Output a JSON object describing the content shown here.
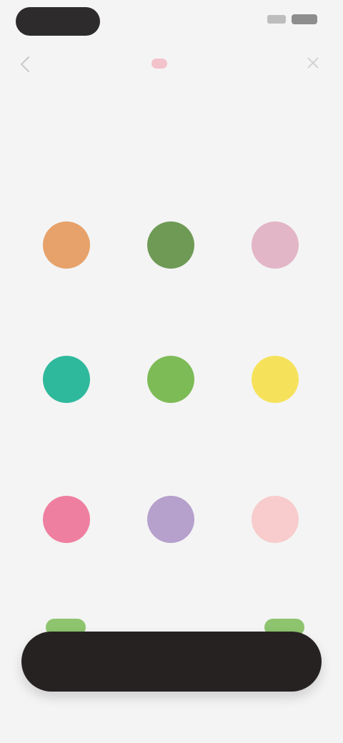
{
  "nav": {
    "back_icon": "chevron-left-icon",
    "close_icon": "close-icon",
    "brand_color": "#f3c2cb"
  },
  "headline": "",
  "categories": [
    {
      "label": "",
      "color": "#e6a26a"
    },
    {
      "label": "",
      "color": "#6f9a55"
    },
    {
      "label": "",
      "color": "#e2b6c7"
    },
    {
      "label": "",
      "color": "#2fb99c"
    },
    {
      "label": "",
      "color": "#7dbb57"
    },
    {
      "label": "",
      "color": "#f6e25a"
    },
    {
      "label": "",
      "color": "#ef7fa0"
    },
    {
      "label": "",
      "color": "#b6a0cc"
    },
    {
      "label": "",
      "color": "#f8cccc"
    }
  ],
  "continue_button": {
    "label": "",
    "color": "#272222"
  }
}
